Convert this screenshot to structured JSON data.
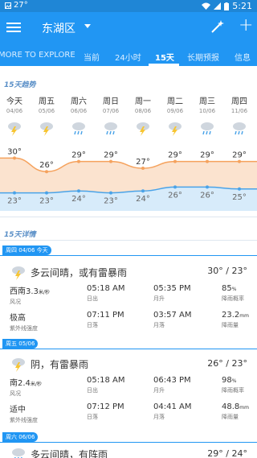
{
  "status_bar": {
    "temperature": "27°",
    "time": "5:21"
  },
  "app_bar": {
    "location": "东湖区"
  },
  "tabs": [
    {
      "label": "MORE TO EXPLORE"
    },
    {
      "label": "当前"
    },
    {
      "label": "24小时"
    },
    {
      "label": "15天"
    },
    {
      "label": "长期预报"
    },
    {
      "label": "信息"
    }
  ],
  "trend": {
    "title": "15天趋势",
    "days": [
      {
        "name": "今天",
        "date": "04/06",
        "icon": "thunder-icon"
      },
      {
        "name": "周五",
        "date": "05/06",
        "icon": "thunder-icon"
      },
      {
        "name": "周六",
        "date": "06/06",
        "icon": "rain-icon"
      },
      {
        "name": "周日",
        "date": "07/06",
        "icon": "rain-icon"
      },
      {
        "name": "周一",
        "date": "08/06",
        "icon": "thunder-icon"
      },
      {
        "name": "周二",
        "date": "09/06",
        "icon": "thunder-icon"
      },
      {
        "name": "周三",
        "date": "10/06",
        "icon": "rain-icon"
      },
      {
        "name": "周四",
        "date": "11/06",
        "icon": "rain-icon"
      }
    ]
  },
  "chart_data": {
    "type": "line",
    "categories": [
      "今天",
      "周五",
      "周六",
      "周日",
      "周一",
      "周二",
      "周三",
      "周四"
    ],
    "series": [
      {
        "values": [
          30,
          26,
          29,
          29,
          27,
          29,
          29,
          29
        ]
      },
      {
        "values": [
          23,
          23,
          24,
          23,
          24,
          26,
          26,
          25
        ]
      }
    ],
    "high_labels": [
      "30°",
      "26°",
      "29°",
      "29°",
      "27°",
      "29°",
      "29°",
      "29°"
    ],
    "low_labels": [
      "23°",
      "23°",
      "24°",
      "23°",
      "24°",
      "26°",
      "26°",
      "25°"
    ],
    "colors": {
      "high": "#f5a25d",
      "low": "#4aa3e8",
      "high_fill": "#fbe3cf",
      "low_fill": "#d7ebfa"
    }
  },
  "details": {
    "title": "15天详情",
    "cards": [
      {
        "day": "周四",
        "date": "04/06",
        "tag": "今天",
        "summary": "多云间晴，或有雷暴雨",
        "temp": "30° / 23°",
        "icon": "thunder-icon",
        "metrics": [
          {
            "value": "西南3.3",
            "unit": "米/秒",
            "label": "风况"
          },
          {
            "value": "05:18 AM",
            "label": "日出"
          },
          {
            "value": "05:35 PM",
            "label": "月升"
          },
          {
            "value": "85",
            "unit": "%",
            "label": "降雨概率"
          },
          {
            "value": "极高",
            "label": "紫外线强度"
          },
          {
            "value": "07:11 PM",
            "label": "日落"
          },
          {
            "value": "03:57 AM",
            "label": "月落"
          },
          {
            "value": "23.2",
            "unit": "mm",
            "label": "降雨量"
          }
        ]
      },
      {
        "day": "周五",
        "date": "05/06",
        "tag": "",
        "summary": "阴，有雷暴雨",
        "temp": "26° / 23°",
        "icon": "thunder-icon",
        "metrics": [
          {
            "value": "南2.4",
            "unit": "米/秒",
            "label": "风况"
          },
          {
            "value": "05:18 AM",
            "label": "日出"
          },
          {
            "value": "06:43 PM",
            "label": "月升"
          },
          {
            "value": "98",
            "unit": "%",
            "label": "降雨概率"
          },
          {
            "value": "适中",
            "label": "紫外线强度"
          },
          {
            "value": "07:12 PM",
            "label": "日落"
          },
          {
            "value": "04:41 AM",
            "label": "月落"
          },
          {
            "value": "48.8",
            "unit": "mm",
            "label": "降雨量"
          }
        ]
      },
      {
        "day": "周六",
        "date": "06/06",
        "tag": "",
        "summary": "多云间晴，有阵雨",
        "temp": "29° / 24°",
        "icon": "rain-icon",
        "metrics": []
      }
    ]
  }
}
